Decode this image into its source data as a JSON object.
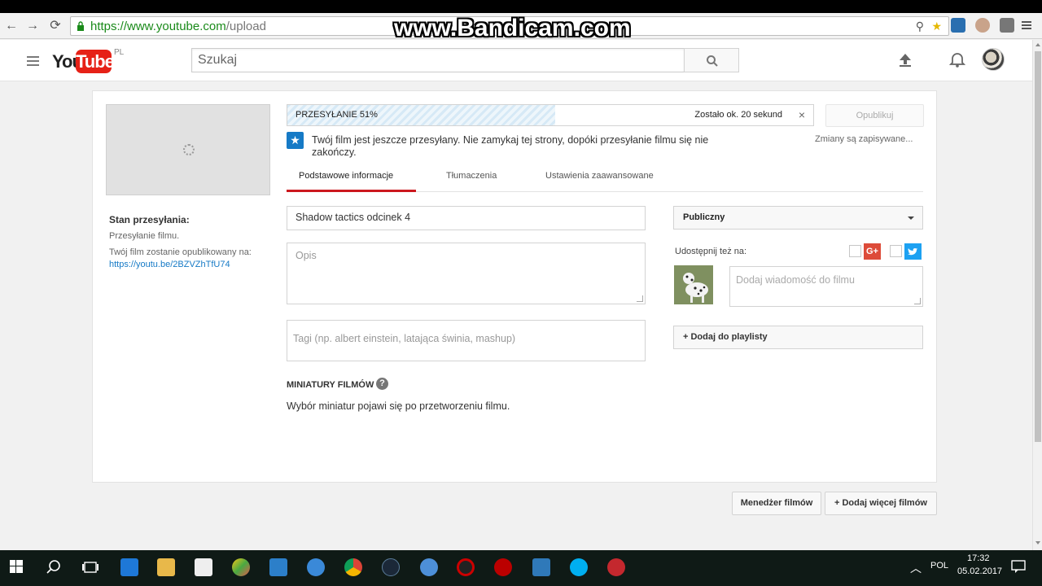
{
  "browser": {
    "url_host": "https://www.youtube.com",
    "url_path": "/upload",
    "watermark": "www.Bandicam.com"
  },
  "header": {
    "logo_you": "You",
    "logo_tube": "Tube",
    "logo_region": "PL",
    "search_placeholder": "Szukaj"
  },
  "sidebar": {
    "status_title": "Stan przesyłania:",
    "status_line1": "Przesyłanie filmu.",
    "status_line2": "Twój film zostanie opublikowany na:",
    "video_link": "https://youtu.be/2BZVZhTfU74"
  },
  "upload": {
    "progress_label": "PRZESYŁANIE 51%",
    "progress_fraction": 0.51,
    "time_left": "Zostało ok. 20 sekund",
    "close_symbol": "×",
    "publish_label": "Opublikuj",
    "saving_text": "Zmiany są zapisywane...",
    "info_text": "Twój film jest jeszcze przesyłany. Nie zamykaj tej strony, dopóki przesyłanie filmu się nie zakończy."
  },
  "tabs": [
    {
      "label": "Podstawowe informacje"
    },
    {
      "label": "Tłumaczenia"
    },
    {
      "label": "Ustawienia zaawansowane"
    }
  ],
  "form": {
    "title_value": "Shadow tactics odcinek 4",
    "description_placeholder": "Opis",
    "tags_placeholder": "Tagi (np. albert einstein, latająca świnia, mashup)",
    "privacy_value": "Publiczny",
    "share_label": "Udostępnij też na:",
    "gplus_label": "G+",
    "share_message_placeholder": "Dodaj wiadomość do filmu",
    "playlist_label": "+ Dodaj do playlisty",
    "thumbnails_title": "MINIATURY FILMÓW",
    "help_symbol": "?",
    "thumbnails_text": "Wybór miniatur pojawi się po przetworzeniu filmu."
  },
  "footer": {
    "manager_label": "Menedżer filmów",
    "add_more_label": "+  Dodaj więcej filmów"
  },
  "taskbar": {
    "language": "POL",
    "time": "17:32",
    "date": "05.02.2017"
  },
  "colors": {
    "youtube_red": "#e62117",
    "link_blue": "#167ac6",
    "tab_underline": "#cc181e",
    "taskbar": "#0f1a16"
  }
}
